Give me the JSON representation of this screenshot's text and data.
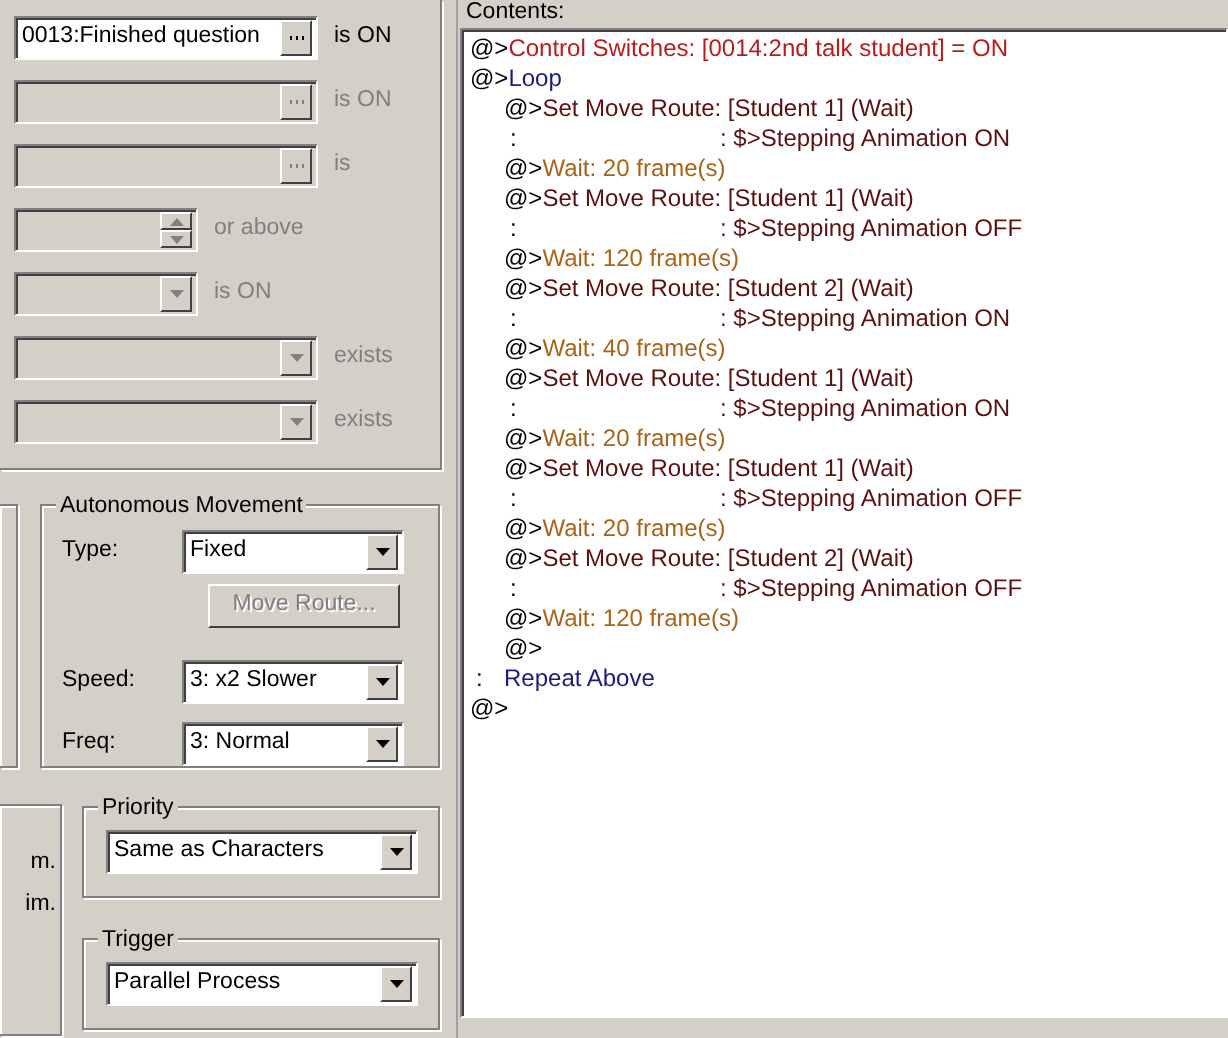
{
  "conditions": [
    {
      "kind": "switch",
      "value": "0013:Finished question",
      "label": "is ON",
      "enabled": true
    },
    {
      "kind": "switch",
      "label": "is ON",
      "enabled": false
    },
    {
      "kind": "variable",
      "label": "is",
      "enabled": false
    },
    {
      "kind": "number",
      "label": "or above",
      "enabled": false
    },
    {
      "kind": "self_switch",
      "label": "is ON",
      "enabled": false
    },
    {
      "kind": "item",
      "label": "exists",
      "enabled": false
    },
    {
      "kind": "actor",
      "label": "exists",
      "enabled": false
    }
  ],
  "options_partial": [
    "m.",
    "im."
  ],
  "autonomous_movement": {
    "title": "Autonomous Movement",
    "type_label": "Type:",
    "type": "Fixed",
    "move_route_button": {
      "label": "Move Route...",
      "disabled": true
    },
    "speed_label": "Speed:",
    "speed": "3: x2 Slower",
    "freq_label": "Freq:",
    "freq": "3: Normal"
  },
  "priority": {
    "title": "Priority",
    "value": "Same as Characters"
  },
  "trigger": {
    "title": "Trigger",
    "value": "Parallel Process"
  },
  "contents": {
    "label": "Contents:",
    "commands": [
      {
        "kind": "switch",
        "prefix": "@>",
        "text": "Control Switches: [0014:2nd talk student] = ON"
      },
      {
        "kind": "loop",
        "prefix": "@>",
        "text": "Loop",
        "children": [
          {
            "kind": "move",
            "prefix": "@>",
            "text": "Set Move Route: [Student 1] (Wait)"
          },
          {
            "kind": "continuation",
            "prefix": ":",
            "text": ": $>Stepping Animation ON"
          },
          {
            "kind": "wait",
            "prefix": "@>",
            "text": "Wait: 20 frame(s)"
          },
          {
            "kind": "move",
            "prefix": "@>",
            "text": "Set Move Route: [Student 1] (Wait)"
          },
          {
            "kind": "continuation",
            "prefix": ":",
            "text": ": $>Stepping Animation OFF"
          },
          {
            "kind": "wait",
            "prefix": "@>",
            "text": "Wait: 120 frame(s)"
          },
          {
            "kind": "move",
            "prefix": "@>",
            "text": "Set Move Route: [Student 2] (Wait)"
          },
          {
            "kind": "continuation",
            "prefix": ":",
            "text": ": $>Stepping Animation ON"
          },
          {
            "kind": "wait",
            "prefix": "@>",
            "text": "Wait: 40 frame(s)"
          },
          {
            "kind": "move",
            "prefix": "@>",
            "text": "Set Move Route: [Student 1] (Wait)"
          },
          {
            "kind": "continuation",
            "prefix": ":",
            "text": ": $>Stepping Animation ON"
          },
          {
            "kind": "wait",
            "prefix": "@>",
            "text": "Wait: 20 frame(s)"
          },
          {
            "kind": "move",
            "prefix": "@>",
            "text": "Set Move Route: [Student 1] (Wait)"
          },
          {
            "kind": "continuation",
            "prefix": ":",
            "text": ": $>Stepping Animation OFF"
          },
          {
            "kind": "wait",
            "prefix": "@>",
            "text": "Wait: 20 frame(s)"
          },
          {
            "kind": "move",
            "prefix": "@>",
            "text": "Set Move Route: [Student 2] (Wait)"
          },
          {
            "kind": "continuation",
            "prefix": ":",
            "text": ": $>Stepping Animation OFF"
          },
          {
            "kind": "wait",
            "prefix": "@>",
            "text": "Wait: 120 frame(s)"
          },
          {
            "kind": "empty",
            "prefix": "@>"
          }
        ]
      },
      {
        "kind": "repeat",
        "prefix": ":",
        "text": "Repeat Above"
      },
      {
        "kind": "empty",
        "prefix": "@>"
      }
    ]
  }
}
